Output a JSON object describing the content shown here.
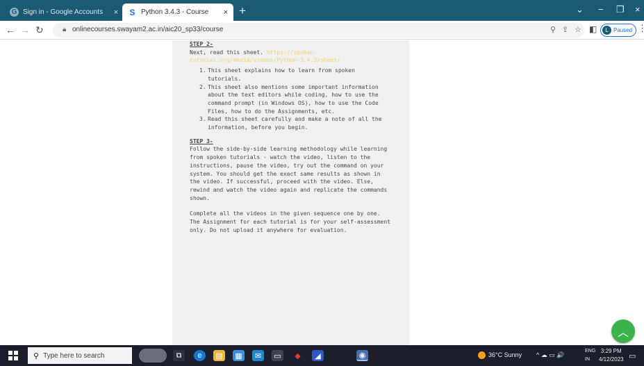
{
  "browser": {
    "tabs": [
      {
        "title": "Sign in - Google Accounts",
        "close": "×"
      },
      {
        "title": "Python 3.4.3 - Course",
        "close": "×"
      }
    ],
    "active_tab_favicon": "S",
    "inactive_tab_favicon": "G",
    "new_tab": "+",
    "window_controls": {
      "chevron": "⌄",
      "minimize": "−",
      "restore": "❐",
      "close": "×"
    },
    "url": "onlinecourses.swayam2.ac.in/aic20_sp33/course",
    "profile": {
      "initial": "L",
      "label": "Paused"
    },
    "icons": [
      "back-icon",
      "forward-icon",
      "reload-icon",
      "lock-icon",
      "zoom-icon",
      "share-icon",
      "star-icon",
      "sidepanel-icon",
      "more-icon"
    ]
  },
  "article": {
    "step2": {
      "heading": "STEP 2-",
      "lead": "Next, read this sheet.",
      "link": "https://spoken-tutorial.org/media/videos/Python-3.4.3/sheet/",
      "items": [
        "This sheet explains how to learn from spoken tutorials.",
        "This sheet also mentions some important information about the text editors while coding, how to use the command prompt (in Windows OS), how to use the Code Files, how to do the Assignments, etc.",
        "Read this sheet carefully and make a note of all the information, before you begin."
      ]
    },
    "step3": {
      "heading": "STEP 3-",
      "para1": "Follow the side-by-side learning methodology while learning from spoken tutorials - watch the video, listen to the instructions, pause the video, try out the command on your system.  You should get the exact same results as shown in the video.  If successful, proceed with the video.  Else, rewind and watch the video again and replicate the commands shown.",
      "para2": "Complete all the videos in the given sequence one by one.",
      "para3": "The Assignment for each tutorial is for your self-assessment only.  Do not upload it anywhere for evaluation."
    }
  },
  "scroll_top_icon": "chevron-up-icon",
  "taskbar": {
    "search_placeholder": "Type here to search",
    "weather": "36°C  Sunny",
    "lang_line1": "ENG",
    "lang_line2": "IN",
    "time": "3:29 PM",
    "date": "4/12/2023",
    "tray_glyphs": "^ ☁ ▭ 🔊"
  },
  "colors": {
    "tab_strip": "#1a5a73",
    "link_highlight": "#ecd56a",
    "fab_green": "#3cb24c",
    "taskbar": "#1b1f2b",
    "content_column": "#f0f0f0"
  }
}
